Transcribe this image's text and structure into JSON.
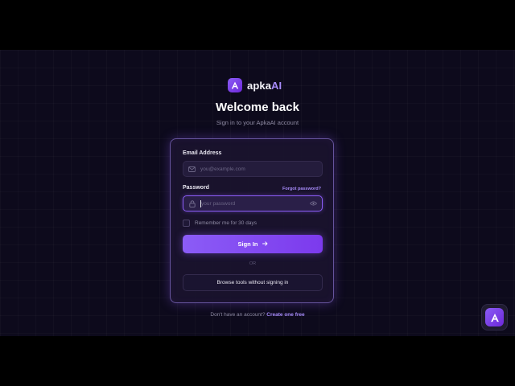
{
  "brand": {
    "name_prefix": "apka",
    "name_suffix": "AI",
    "logo_letter": "A",
    "accent": "#8b5cf6"
  },
  "header": {
    "title": "Welcome back",
    "subtitle": "Sign in to your ApkaAI account"
  },
  "form": {
    "email": {
      "label": "Email Address",
      "placeholder": "you@example.com",
      "value": "",
      "icon": "mail-icon"
    },
    "password": {
      "label": "Password",
      "placeholder": "your password",
      "value": "",
      "icon": "lock-icon",
      "toggle_icon": "eye-icon",
      "forgot_label": "Forgot password?"
    },
    "remember": {
      "label": "Remember me for 30 days",
      "checked": false
    },
    "submit": {
      "label": "Sign In",
      "icon": "arrow-right-icon"
    },
    "divider": "OR",
    "browse_label": "Browse tools without signing in"
  },
  "footer": {
    "prompt": "Don't have an account?",
    "link": "Create one free"
  },
  "fab": {
    "letter": "A",
    "icon": "apka-logo-icon"
  }
}
